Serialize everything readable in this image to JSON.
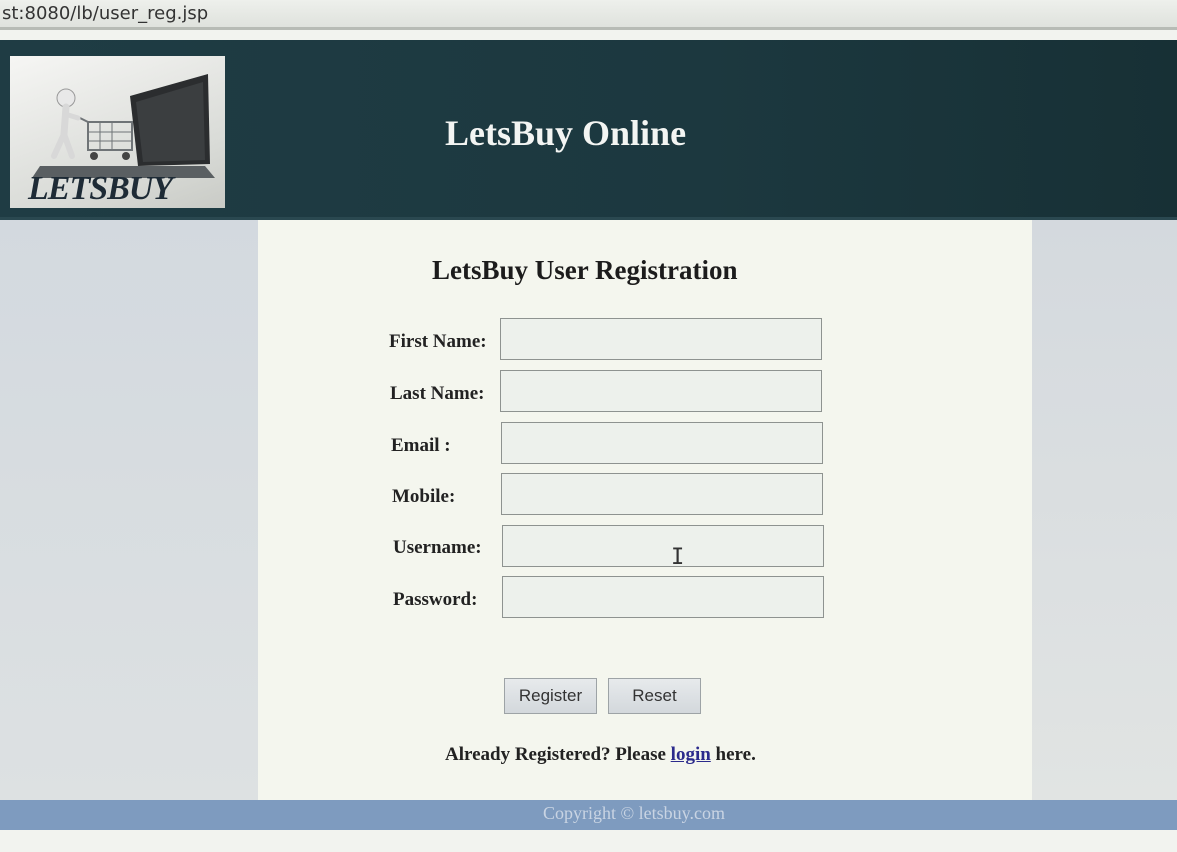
{
  "browser": {
    "url": "st:8080/lb/user_reg.jsp"
  },
  "header": {
    "logo_text": "LETSBUY",
    "site_title": "LetsBuy Online"
  },
  "form": {
    "title": "LetsBuy User Registration",
    "fields": [
      {
        "label": "First Name:",
        "value": ""
      },
      {
        "label": "Last Name:",
        "value": ""
      },
      {
        "label": "Email :",
        "value": ""
      },
      {
        "label": "Mobile:",
        "value": ""
      },
      {
        "label": "Username:",
        "value": ""
      },
      {
        "label": "Password:",
        "value": ""
      }
    ],
    "register_label": "Register",
    "reset_label": "Reset",
    "already_prefix": "Already Registered? Please",
    "login_link": "login",
    "already_suffix": "here."
  },
  "footer": {
    "copyright": "Copyright © letsbuy.com"
  },
  "colors": {
    "header_bg": "#1f3c44",
    "footer_bg": "#7e9bbf",
    "content_bg": "#f4f6ee",
    "link": "#2b2a8c"
  }
}
